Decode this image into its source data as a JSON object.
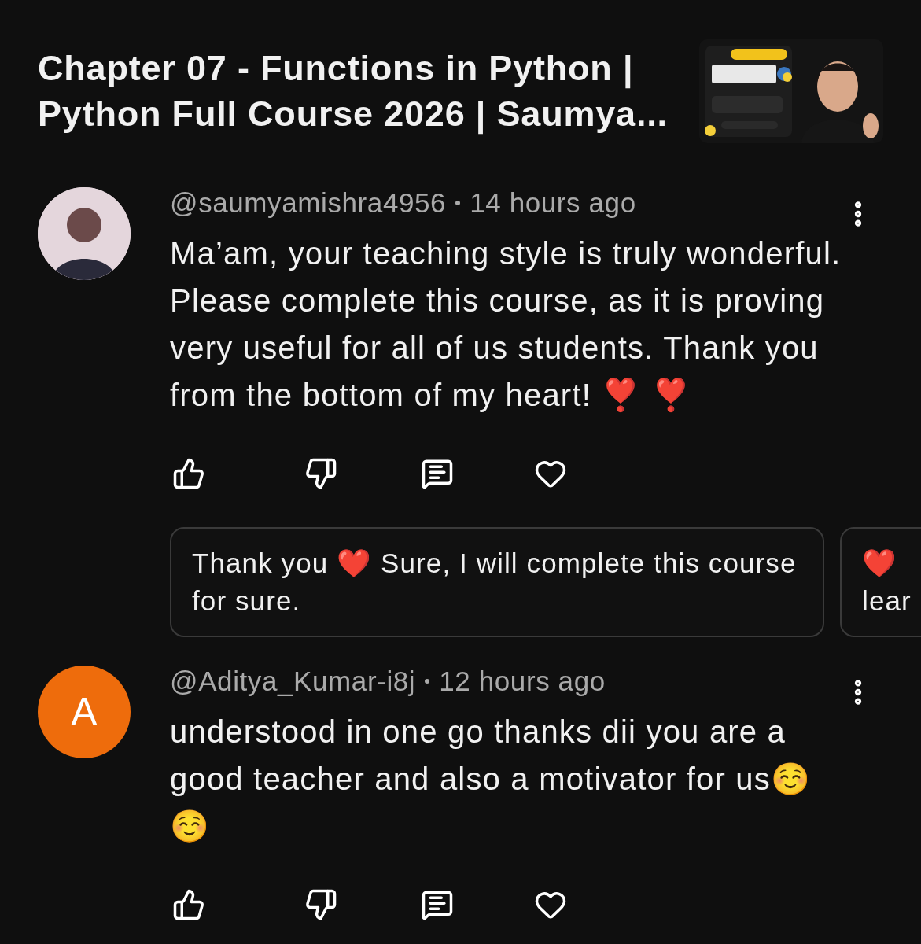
{
  "video": {
    "title": "Chapter 07 - Functions in Python | Python Full Course 2026 | Saumya..."
  },
  "comments": [
    {
      "author": "@saumyamishra4956",
      "time": "14 hours ago",
      "text": "Ma’am, your teaching style is truly wonderful. Please complete this course, as it is proving very useful for all of us students. Thank you from the bottom of my heart! ❣️ ❣️",
      "replies": [
        "Thank you ❤️ Sure, I will complete this course for sure.",
        "❤️\nlear"
      ]
    },
    {
      "avatar": {
        "kind": "letter",
        "letter": "A",
        "color": "#ee6c0c"
      },
      "author": "@Aditya_Kumar-i8j",
      "time": "12 hours ago",
      "text": "understood in one go thanks dii you are a good teacher and also a motivator for us☺️ ☺️"
    }
  ]
}
